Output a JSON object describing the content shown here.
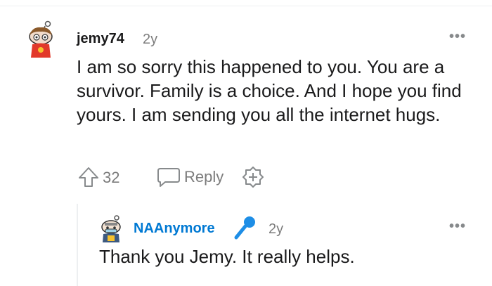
{
  "comment": {
    "username": "jemy74",
    "time": "2y",
    "more_label": "•••",
    "text": "I am so sorry this happened to you. You are a survivor. Family is a choice. And I hope you find yours. I am sending you all the internet hugs.",
    "upvotes": "32",
    "reply_label": "Reply"
  },
  "reply": {
    "username": "NAAnymore",
    "time": "2y",
    "more_label": "•••",
    "text": "Thank you Jemy. It really helps."
  },
  "colors": {
    "reply_username": "#0079d3",
    "meta_gray": "#7c7c7c",
    "flair_blue": "#1e8ee6"
  },
  "icons": [
    "snoo-avatar-icon",
    "upvote-arrow-icon",
    "reply-bubble-icon",
    "add-award-icon",
    "microphone-flair-icon",
    "more-options-icon"
  ]
}
